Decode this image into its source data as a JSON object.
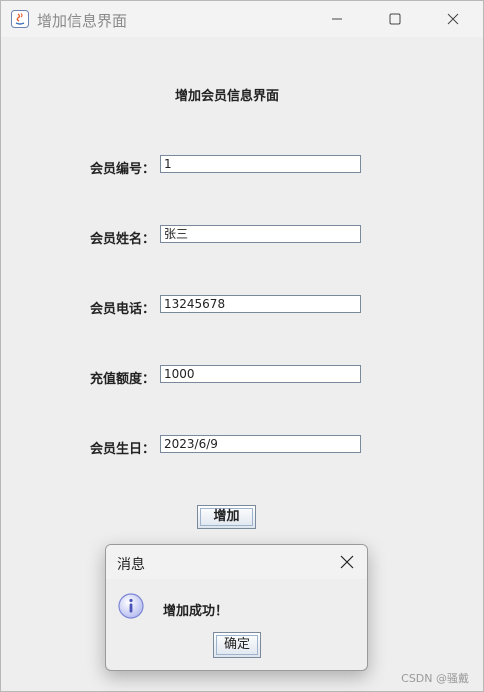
{
  "window": {
    "title": "增加信息界面",
    "minimize_glyph": "—",
    "close_glyph": "✕"
  },
  "form": {
    "heading": "增加会员信息界面",
    "fields": [
      {
        "label": "会员编号：",
        "value": "1"
      },
      {
        "label": "会员姓名：",
        "value": "张三"
      },
      {
        "label": "会员电话：",
        "value": "13245678"
      },
      {
        "label": "充值额度：",
        "value": "1000"
      },
      {
        "label": "会员生日：",
        "value": "2023/6/9"
      }
    ],
    "add_button": "增加"
  },
  "dialog": {
    "title": "消息",
    "message": "增加成功！",
    "ok_button": "确定",
    "icon": "info-icon"
  },
  "watermark": "CSDN @骚戴",
  "colors": {
    "field_border": "#7a8a9c",
    "info_icon": "#7b85d6"
  }
}
